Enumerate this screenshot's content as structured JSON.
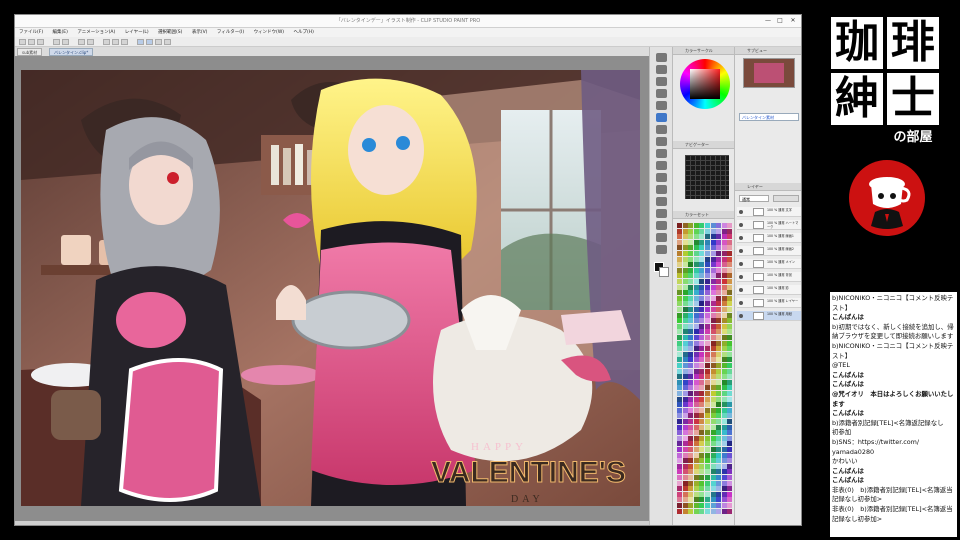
{
  "window": {
    "title": "「バレンタインデー」イラスト制作 - CLIP STUDIO PAINT PRO",
    "minimize": "—",
    "maximize": "□",
    "close": "✕"
  },
  "menu": [
    "ファイル(F)",
    "編集(E)",
    "アニメーション(A)",
    "レイヤー(L)",
    "選択範囲(S)",
    "表示(V)",
    "フィルター(I)",
    "ウィンドウ(W)",
    "ヘルプ(H)"
  ],
  "canvas_tabs": [
    "sub素材",
    "バレンタイン.clip*"
  ],
  "artwork": {
    "headline_small": "HAPPY",
    "headline": "VALENTINE'S",
    "headline_day": "DAY"
  },
  "panels": {
    "color_wheel": "カラーサークル",
    "navigator": "ナビゲーター",
    "color_set": "カラーセット",
    "sub_view": "サブビュー",
    "layer": "レイヤー",
    "blend_mode": "通常",
    "sub_view_label": "バレンタイン素材"
  },
  "layers": [
    {
      "name": "100 % 通常 文字"
    },
    {
      "name": "100 % 通常 ハートマーク"
    },
    {
      "name": "100 % 通常 線画1"
    },
    {
      "name": "100 % 通常 線画2"
    },
    {
      "name": "100 % 通常 メイン"
    },
    {
      "name": "100 % 通常 背景"
    },
    {
      "name": "100 % 通常 影"
    },
    {
      "name": "100 % 通常 レイヤー"
    },
    {
      "name": "100 % 通常 用紙"
    }
  ],
  "colors": {
    "accent": "#e8559a",
    "titlebar": "#fafafa",
    "panel": "#e8e8e8",
    "emblem_red": "#cc1111"
  },
  "icons": {
    "pen": "pen-icon",
    "brush": "brush-icon",
    "eraser": "eraser-icon",
    "fill": "fill-icon",
    "eye": "eye-icon"
  },
  "logo": {
    "k1": "珈",
    "k2": "琲",
    "k3": "紳",
    "k4": "士",
    "sub": "の部屋"
  },
  "chat": [
    {
      "text": "b)NICONIKO・ニコニコ【コメント反映テ",
      "bold": false
    },
    {
      "text": "スト】",
      "bold": false
    },
    {
      "text": "こんばんは",
      "bold": true
    },
    {
      "text": "b)初期ではなく、新しく接続を追加し、帰",
      "bold": false
    },
    {
      "text": "納ブラウザを変更して即接続お願いします",
      "bold": false
    },
    {
      "text": "b)NICONIKO・ニコニコ【コメント反映テ",
      "bold": false
    },
    {
      "text": "スト】",
      "bold": false
    },
    {
      "text": "@TEL",
      "bold": false
    },
    {
      "text": "こんばんは",
      "bold": true
    },
    {
      "text": "こんばんは",
      "bold": true
    },
    {
      "text": "@咒イオリ　本日はよろしくお願いいたし",
      "bold": true
    },
    {
      "text": "ます",
      "bold": true
    },
    {
      "text": "こんばんは",
      "bold": true
    },
    {
      "text": "b)添籍者別記録[TEL]<名簿返記録なし",
      "bold": false
    },
    {
      "text": "初参加",
      "bold": false
    },
    {
      "text": "b)SNS：https://twitter.com/",
      "bold": false
    },
    {
      "text": "yamada0280",
      "bold": false
    },
    {
      "text": "かわいい",
      "bold": false
    },
    {
      "text": "こんばんは",
      "bold": true
    },
    {
      "text": "こんばんは",
      "bold": true
    },
    {
      "text": "非表(0)　b)添籍者別記録[TEL]<名簿返当",
      "bold": false
    },
    {
      "text": "記録なし初参加>",
      "bold": false
    },
    {
      "text": "非表(0)　b)添籍者別記録[TEL]<名簿返当",
      "bold": false
    },
    {
      "text": "記録なし初参加>",
      "bold": false
    }
  ]
}
